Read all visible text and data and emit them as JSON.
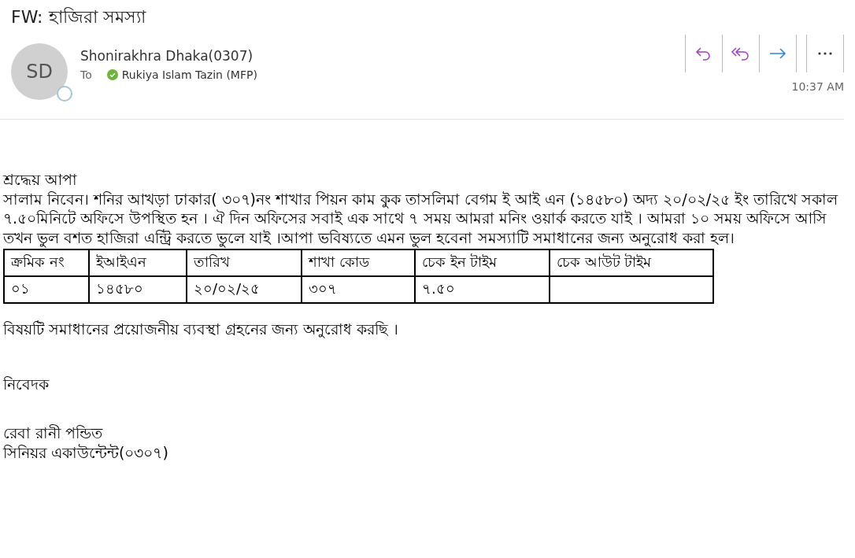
{
  "subject": "FW: হাজিরা সমস্যা",
  "sender": {
    "initials": "SD",
    "name": "Shonirakhra Dhaka(0307)"
  },
  "recipients": {
    "label": "To",
    "items": [
      {
        "name": "Rukiya Islam Tazin (MFP)"
      }
    ]
  },
  "actions": [
    {
      "kind": "reply"
    },
    {
      "kind": "reply_all"
    },
    {
      "kind": "forward"
    },
    {
      "kind": "more"
    }
  ],
  "time": "10:37 AM",
  "body": {
    "greeting": "শ্রদ্ধেয় আপা",
    "paragraph": "সালাম নিবেন। শনির আখড়া ঢাকার( ৩০৭)নং শাখার পিয়ন কাম কুক তাসলিমা বেগম ই আই এন (১৪৫৮০) অদ্য ২০/০২/২৫ ইং তারিখে সকাল ৭.৫০মিনিটে অফিসে উপস্থিত হন । ঐ দিন অফিসের সবাই এক সাথে ৭ সময় আমরা মনিং ওয়ার্ক করতে যাই । আমরা ১০ সময় অফিসে আসি তখন ভুল বশত হাজিরা এন্ট্রি করতে ভুলে যাই ।আপা ভবিষ্যতে এমন ভুল হবেনা সমস্যাটি সমাধানের জন্য অনুরোধ করা হল।",
    "table": {
      "columns": [
        "ক্রমিক নং",
        "ইআইএন",
        "তারিখ",
        "শাখা কোড",
        "চেক ইন টাইম",
        "চেক আউট টাইম"
      ],
      "rows": [
        [
          "০১",
          "১৪৫৮০",
          "২০/০২/২৫",
          "৩০৭",
          "৭.৫০",
          null
        ]
      ]
    },
    "request": "বিষয়টি সমাধানের প্রয়োজনীয় ব্যবস্থা গ্রহনের জন্য অনুরোধ করছি ।",
    "closing": "নিবেদক",
    "signature": [
      "রেবা রানী পন্ডিত",
      "সিনিয়র একাউন্টেন্ট(০৩০৭)"
    ]
  }
}
